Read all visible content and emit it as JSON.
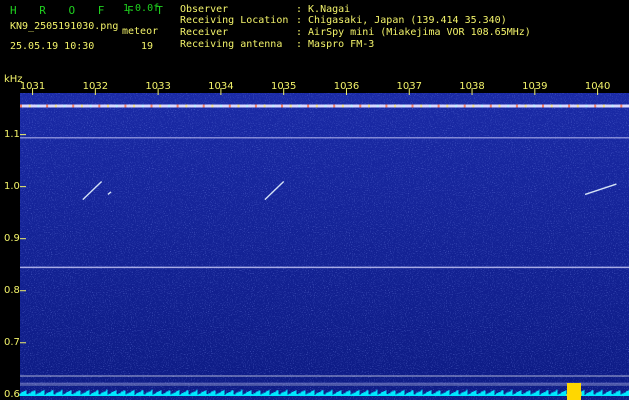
{
  "header": {
    "title": "H R O F F T",
    "version": "1.0.0f",
    "filename": "KN9_2505191030.png",
    "datetime": "25.05.19 10:30",
    "mode_label": "meteor",
    "count": "19",
    "meta": [
      {
        "label": "Observer",
        "value": ": K.Nagai"
      },
      {
        "label": "Receiving Location",
        "value": ": Chigasaki, Japan (139.414 35.340)"
      },
      {
        "label": "Receiver",
        "value": ": AirSpy mini (Miakejima VOR 108.65MHz)"
      },
      {
        "label": "Receiving antenna",
        "value": ": Maspro FM-3"
      }
    ]
  },
  "chart_data": {
    "type": "heatmap",
    "yunit": "kHz",
    "x_ticks": [
      "1031",
      "1032",
      "1033",
      "1034",
      "1035",
      "1036",
      "1037",
      "1038",
      "1039",
      "1040"
    ],
    "y_ticks": [
      "1.1",
      "1.0",
      "0.9",
      "0.8",
      "0.7",
      "0.6"
    ],
    "x_range": [
      1030.8,
      1040.5
    ],
    "y_range": [
      0.59,
      1.18
    ],
    "carrier_lines": [
      {
        "y": 1.155,
        "intensity": 1.0
      },
      {
        "y": 1.094,
        "intensity": 0.55
      },
      {
        "y": 0.845,
        "intensity": 0.75
      },
      {
        "y": 0.622,
        "intensity": 0.35
      }
    ],
    "meteor_echoes": [
      {
        "x_start": 1031.8,
        "x_end": 1032.1,
        "y_start": 0.975,
        "y_end": 1.01
      },
      {
        "x_start": 1032.2,
        "x_end": 1032.25,
        "y_start": 0.985,
        "y_end": 0.99
      },
      {
        "x_start": 1034.7,
        "x_end": 1035.0,
        "y_start": 0.975,
        "y_end": 1.01
      },
      {
        "x_start": 1039.8,
        "x_end": 1040.3,
        "y_start": 0.985,
        "y_end": 1.005
      }
    ],
    "xlabel": "",
    "ylabel": "kHz",
    "grid": false
  },
  "colors": {
    "background": "#000000",
    "title_green": "#1fd11f",
    "label_yellow": "#f3f36a",
    "spectrogram_bg": "#0f1f8b",
    "carrier": "#d8d8ff",
    "bottom_trace": "#00e8ff",
    "burst": "#ffd700"
  }
}
